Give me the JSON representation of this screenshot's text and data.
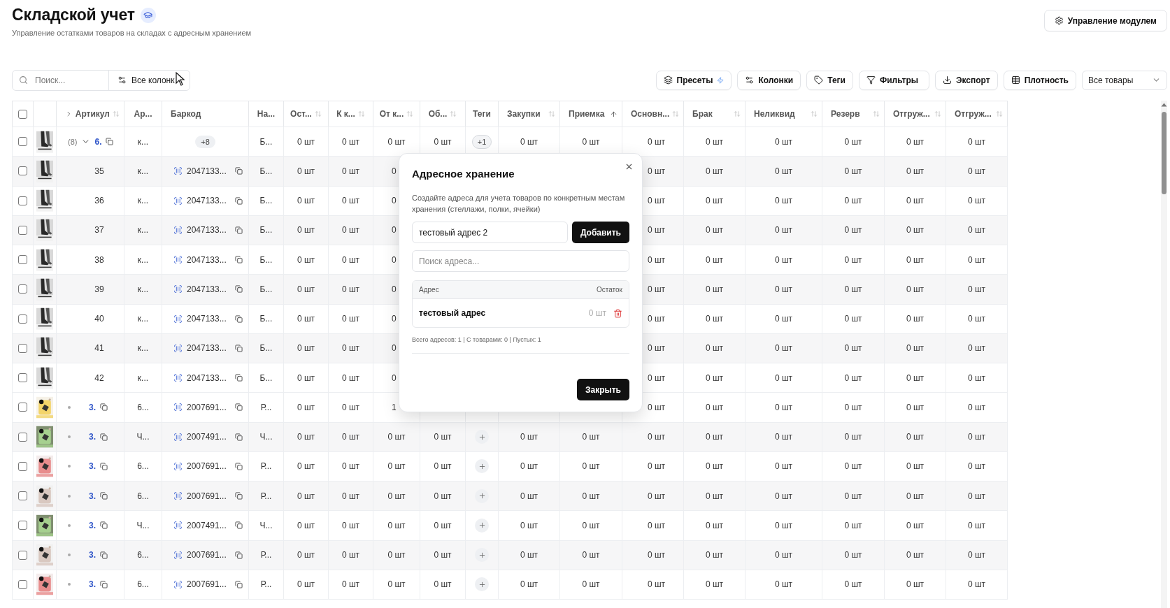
{
  "header": {
    "title": "Складской учет",
    "subtitle": "Управление остатками товаров на складах с адресным хранением",
    "module_button": "Управление модулем"
  },
  "toolbar": {
    "search": {
      "placeholder": "Поиск..."
    },
    "column_scope": "Все колонк",
    "buttons": [
      {
        "kind": "presets",
        "label": "Пресеты"
      },
      {
        "kind": "columns",
        "label": "Колонки"
      },
      {
        "kind": "tags",
        "label": "Теги"
      },
      {
        "kind": "filters",
        "label": "Фильтры"
      },
      {
        "kind": "export",
        "label": "Экспорт"
      },
      {
        "kind": "density",
        "label": "Плотность"
      }
    ],
    "view_select": "Все товары"
  },
  "table": {
    "select_all": {
      "checked": false
    },
    "columns": [
      {
        "label": "Артикул",
        "sortable": true,
        "sort_active": false
      },
      {
        "label": "Ар...",
        "sortable": false
      },
      {
        "label": "Баркод",
        "sortable": false
      },
      {
        "label": "На...",
        "sortable": false
      },
      {
        "label": "Ост...",
        "sortable": true,
        "sort_active": false
      },
      {
        "label": "К к...",
        "sortable": true,
        "sort_active": false
      },
      {
        "label": "От к...",
        "sortable": true,
        "sort_active": false
      },
      {
        "label": "Об...",
        "sortable": true,
        "sort_active": false
      },
      {
        "label": "Теги",
        "sortable": false
      },
      {
        "label": "Закупки",
        "sortable": true,
        "sort_active": false
      },
      {
        "label": "Приемка",
        "sortable": true,
        "sort_active": true
      },
      {
        "label": "Основн...",
        "sortable": true,
        "sort_active": false
      },
      {
        "label": "Брак",
        "sortable": true,
        "sort_active": false
      },
      {
        "label": "Неликвид",
        "sortable": true,
        "sort_active": false
      },
      {
        "label": "Резерв",
        "sortable": true,
        "sort_active": false
      },
      {
        "label": "Отгруж...",
        "sortable": true,
        "sort_active": false
      },
      {
        "label": "Отгруж...",
        "sortable": true,
        "sort_active": false
      }
    ],
    "rows": [
      {
        "kind": "group",
        "checked": false,
        "expanded": true,
        "count": "(8)",
        "article": "6.",
        "ar": "к...",
        "barcode": "+8",
        "na": "Б...",
        "ost": "0 шт",
        "k_k": "0 шт",
        "ot_k": "0 шт",
        "ob": "0 шт",
        "tags": "+1",
        "zakupki": "0 шт",
        "priemka": "0 шт",
        "osnovn": "0 шт",
        "brak": "0 шт",
        "nelikvid": "0 шт",
        "rezerv": "0 шт",
        "otgruzh_1": "0 шт",
        "otgruzh_2": "0 шт",
        "children": [
          {
            "kind": "variant",
            "checked": false,
            "article": "35",
            "ar": "к...",
            "barcode": "2047133...",
            "na": "Б...",
            "ost": "0 шт",
            "k_k": "0 шт",
            "ot_k": "0",
            "osnovn": "0 шт",
            "brak": "0 шт",
            "nelikvid": "0 шт",
            "rezerv": "0 шт",
            "otgruzh_1": "0 шт",
            "otgruzh_2": "0 шт"
          },
          {
            "kind": "variant",
            "checked": false,
            "article": "36",
            "ar": "к...",
            "barcode": "2047133...",
            "na": "Б...",
            "ost": "0 шт",
            "k_k": "0 шт",
            "ot_k": "0",
            "osnovn": "0 шт",
            "brak": "0 шт",
            "nelikvid": "0 шт",
            "rezerv": "0 шт",
            "otgruzh_1": "0 шт",
            "otgruzh_2": "0 шт"
          },
          {
            "kind": "variant",
            "checked": false,
            "article": "37",
            "ar": "к...",
            "barcode": "2047133...",
            "na": "Б...",
            "ost": "0 шт",
            "k_k": "0 шт",
            "ot_k": "0",
            "osnovn": "0 шт",
            "brak": "0 шт",
            "nelikvid": "0 шт",
            "rezerv": "0 шт",
            "otgruzh_1": "0 шт",
            "otgruzh_2": "0 шт"
          },
          {
            "kind": "variant",
            "checked": false,
            "article": "38",
            "ar": "к...",
            "barcode": "2047133...",
            "na": "Б...",
            "ost": "0 шт",
            "k_k": "0 шт",
            "ot_k": "0",
            "osnovn": "0 шт",
            "brak": "0 шт",
            "nelikvid": "0 шт",
            "rezerv": "0 шт",
            "otgruzh_1": "0 шт",
            "otgruzh_2": "0 шт"
          },
          {
            "kind": "variant",
            "checked": false,
            "article": "39",
            "ar": "к...",
            "barcode": "2047133...",
            "na": "Б...",
            "ost": "0 шт",
            "k_k": "0 шт",
            "ot_k": "0",
            "osnovn": "0 шт",
            "brak": "0 шт",
            "nelikvid": "0 шт",
            "rezerv": "0 шт",
            "otgruzh_1": "0 шт",
            "otgruzh_2": "0 шт"
          },
          {
            "kind": "variant",
            "checked": false,
            "article": "40",
            "ar": "к...",
            "barcode": "2047133...",
            "na": "Б...",
            "ost": "0 шт",
            "k_k": "0 шт",
            "ot_k": "0",
            "osnovn": "0 шт",
            "brak": "0 шт",
            "nelikvid": "0 шт",
            "rezerv": "0 шт",
            "otgruzh_1": "0 шт",
            "otgruzh_2": "0 шт"
          },
          {
            "kind": "variant",
            "checked": false,
            "article": "41",
            "ar": "к...",
            "barcode": "2047133...",
            "na": "Б...",
            "ost": "0 шт",
            "k_k": "0 шт",
            "ot_k": "0",
            "osnovn": "0 шт",
            "brak": "0 шт",
            "nelikvid": "0 шт",
            "rezerv": "0 шт",
            "otgruzh_1": "0 шт",
            "otgruzh_2": "0 шт"
          },
          {
            "kind": "variant",
            "checked": false,
            "article": "42",
            "ar": "к...",
            "barcode": "2047133...",
            "na": "Б...",
            "ost": "0 шт",
            "k_k": "0 шт",
            "ot_k": "0",
            "osnovn": "0 шт",
            "brak": "0 шт",
            "nelikvid": "0 шт",
            "rezerv": "0 шт",
            "otgruzh_1": "0 шт",
            "otgruzh_2": "0 шт"
          }
        ]
      },
      {
        "kind": "product",
        "checked": false,
        "article": "3.",
        "ar": "6...",
        "barcode": "2007691...",
        "na": "Р...",
        "ost": "0 шт",
        "k_k": "0 шт",
        "ot_k": "1",
        "osnovn": "0 шт",
        "brak": "0 шт",
        "nelikvid": "0 шт",
        "rezerv": "0 шт",
        "otgruzh_1": "0 шт",
        "otgruzh_2": "0 шт"
      },
      {
        "kind": "product",
        "checked": false,
        "article": "3.",
        "ar": "Ч...",
        "barcode": "2007491...",
        "na": "Ч...",
        "ost": "0 шт",
        "k_k": "0 шт",
        "ot_k": "0 шт",
        "ob": "0 шт",
        "add_tag": true,
        "zakupki": "0 шт",
        "priemka": "0 шт",
        "osnovn": "0 шт",
        "brak": "0 шт",
        "nelikvid": "0 шт",
        "rezerv": "0 шт",
        "otgruzh_1": "0 шт",
        "otgruzh_2": "0 шт"
      },
      {
        "kind": "product",
        "checked": false,
        "article": "3.",
        "ar": "6...",
        "barcode": "2007691...",
        "na": "Р...",
        "ost": "0 шт",
        "k_k": "0 шт",
        "ot_k": "0 шт",
        "ob": "0 шт",
        "add_tag": true,
        "zakupki": "0 шт",
        "priemka": "0 шт",
        "osnovn": "0 шт",
        "brak": "0 шт",
        "nelikvid": "0 шт",
        "rezerv": "0 шт",
        "otgruzh_1": "0 шт",
        "otgruzh_2": "0 шт"
      },
      {
        "kind": "product",
        "checked": false,
        "article": "3.",
        "ar": "6...",
        "barcode": "2007691...",
        "na": "Р...",
        "ost": "0 шт",
        "k_k": "0 шт",
        "ot_k": "0 шт",
        "ob": "0 шт",
        "add_tag": true,
        "zakupki": "0 шт",
        "priemka": "0 шт",
        "osnovn": "0 шт",
        "brak": "0 шт",
        "nelikvid": "0 шт",
        "rezerv": "0 шт",
        "otgruzh_1": "0 шт",
        "otgruzh_2": "0 шт"
      },
      {
        "kind": "product",
        "checked": false,
        "article": "3.",
        "ar": "Ч...",
        "barcode": "2007491...",
        "na": "Ч...",
        "ost": "0 шт",
        "k_k": "0 шт",
        "ot_k": "0 шт",
        "ob": "0 шт",
        "add_tag": true,
        "zakupki": "0 шт",
        "priemka": "0 шт",
        "osnovn": "0 шт",
        "brak": "0 шт",
        "nelikvid": "0 шт",
        "rezerv": "0 шт",
        "otgruzh_1": "0 шт",
        "otgruzh_2": "0 шт"
      },
      {
        "kind": "product",
        "checked": false,
        "article": "3.",
        "ar": "6...",
        "barcode": "2007691...",
        "na": "Р...",
        "ost": "0 шт",
        "k_k": "0 шт",
        "ot_k": "0 шт",
        "ob": "0 шт",
        "add_tag": true,
        "zakupki": "0 шт",
        "priemka": "0 шт",
        "osnovn": "0 шт",
        "brak": "0 шт",
        "nelikvid": "0 шт",
        "rezerv": "0 шт",
        "otgruzh_1": "0 шт",
        "otgruzh_2": "0 шт"
      },
      {
        "kind": "product",
        "checked": false,
        "article": "3.",
        "ar": "6...",
        "barcode": "2007691...",
        "na": "Р...",
        "ost": "0 шт",
        "k_k": "0 шт",
        "ot_k": "0 шт",
        "ob": "0 шт",
        "add_tag": true,
        "zakupki": "0 шт",
        "priemka": "0 шт",
        "osnovn": "0 шт",
        "brak": "0 шт",
        "nelikvid": "0 шт",
        "rezerv": "0 шт",
        "otgruzh_1": "0 шт",
        "otgruzh_2": "0 шт"
      }
    ]
  },
  "address_modal": {
    "title": "Адресное хранение",
    "description": "Создайте адреса для учета товаров по конкретным местам хранения (стеллажи, полки, ячейки)",
    "new_address": {
      "value": "тестовый адрес 2"
    },
    "add_button": "Добавить",
    "search": {
      "placeholder": "Поиск адреса..."
    },
    "columns": [
      "Адрес",
      "Остаток"
    ],
    "addresses": [
      {
        "name": "тестовый адрес",
        "stock": "0 шт"
      }
    ],
    "summary": "Всего адресов: 1 | С товарами: 0 | Пустых: 1",
    "close_button": "Закрыть"
  }
}
